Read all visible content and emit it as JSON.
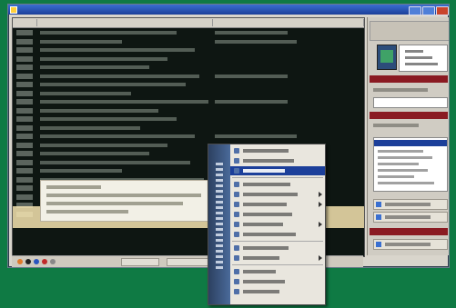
{
  "window": {
    "title": ""
  },
  "list": {
    "columns": [
      {
        "label": ""
      },
      {
        "label": ""
      },
      {
        "label": ""
      }
    ],
    "rows": [
      {
        "time": "",
        "text": "",
        "extra": ""
      },
      {
        "time": "",
        "text": "",
        "extra": ""
      },
      {
        "time": "",
        "text": "",
        "extra": ""
      },
      {
        "time": "",
        "text": "",
        "extra": ""
      },
      {
        "time": "",
        "text": "",
        "extra": ""
      },
      {
        "time": "",
        "text": "",
        "extra": ""
      },
      {
        "time": "",
        "text": "",
        "extra": ""
      },
      {
        "time": "",
        "text": "",
        "extra": ""
      },
      {
        "time": "",
        "text": "",
        "extra": ""
      },
      {
        "time": "",
        "text": "",
        "extra": ""
      },
      {
        "time": "",
        "text": "",
        "extra": ""
      },
      {
        "time": "",
        "text": "",
        "extra": ""
      },
      {
        "time": "",
        "text": "",
        "extra": ""
      },
      {
        "time": "",
        "text": "",
        "extra": ""
      },
      {
        "time": "",
        "text": "",
        "extra": ""
      },
      {
        "time": "",
        "text": "",
        "extra": ""
      },
      {
        "time": "",
        "text": "",
        "extra": ""
      },
      {
        "time": "",
        "text": "",
        "extra": ""
      },
      {
        "time": "",
        "text": "",
        "extra": ""
      },
      {
        "time": "",
        "text": "",
        "extra": ""
      },
      {
        "time": "",
        "text": "",
        "extra": ""
      },
      {
        "time": "",
        "text": "",
        "extra": ""
      }
    ]
  },
  "right_panel": {
    "section1": "",
    "section2": "",
    "section3": "",
    "calendar_text": ""
  },
  "context_menu": {
    "items": [
      "",
      "",
      "",
      "",
      "",
      "",
      "",
      "",
      "",
      "",
      "",
      "",
      "",
      ""
    ]
  },
  "colors": {
    "desktop": "#0f7a44",
    "list_bg": "#0e1612",
    "title_bar": "#1c3f9a",
    "section_header": "#8a1a22",
    "highlight": "#1c3f9a"
  }
}
